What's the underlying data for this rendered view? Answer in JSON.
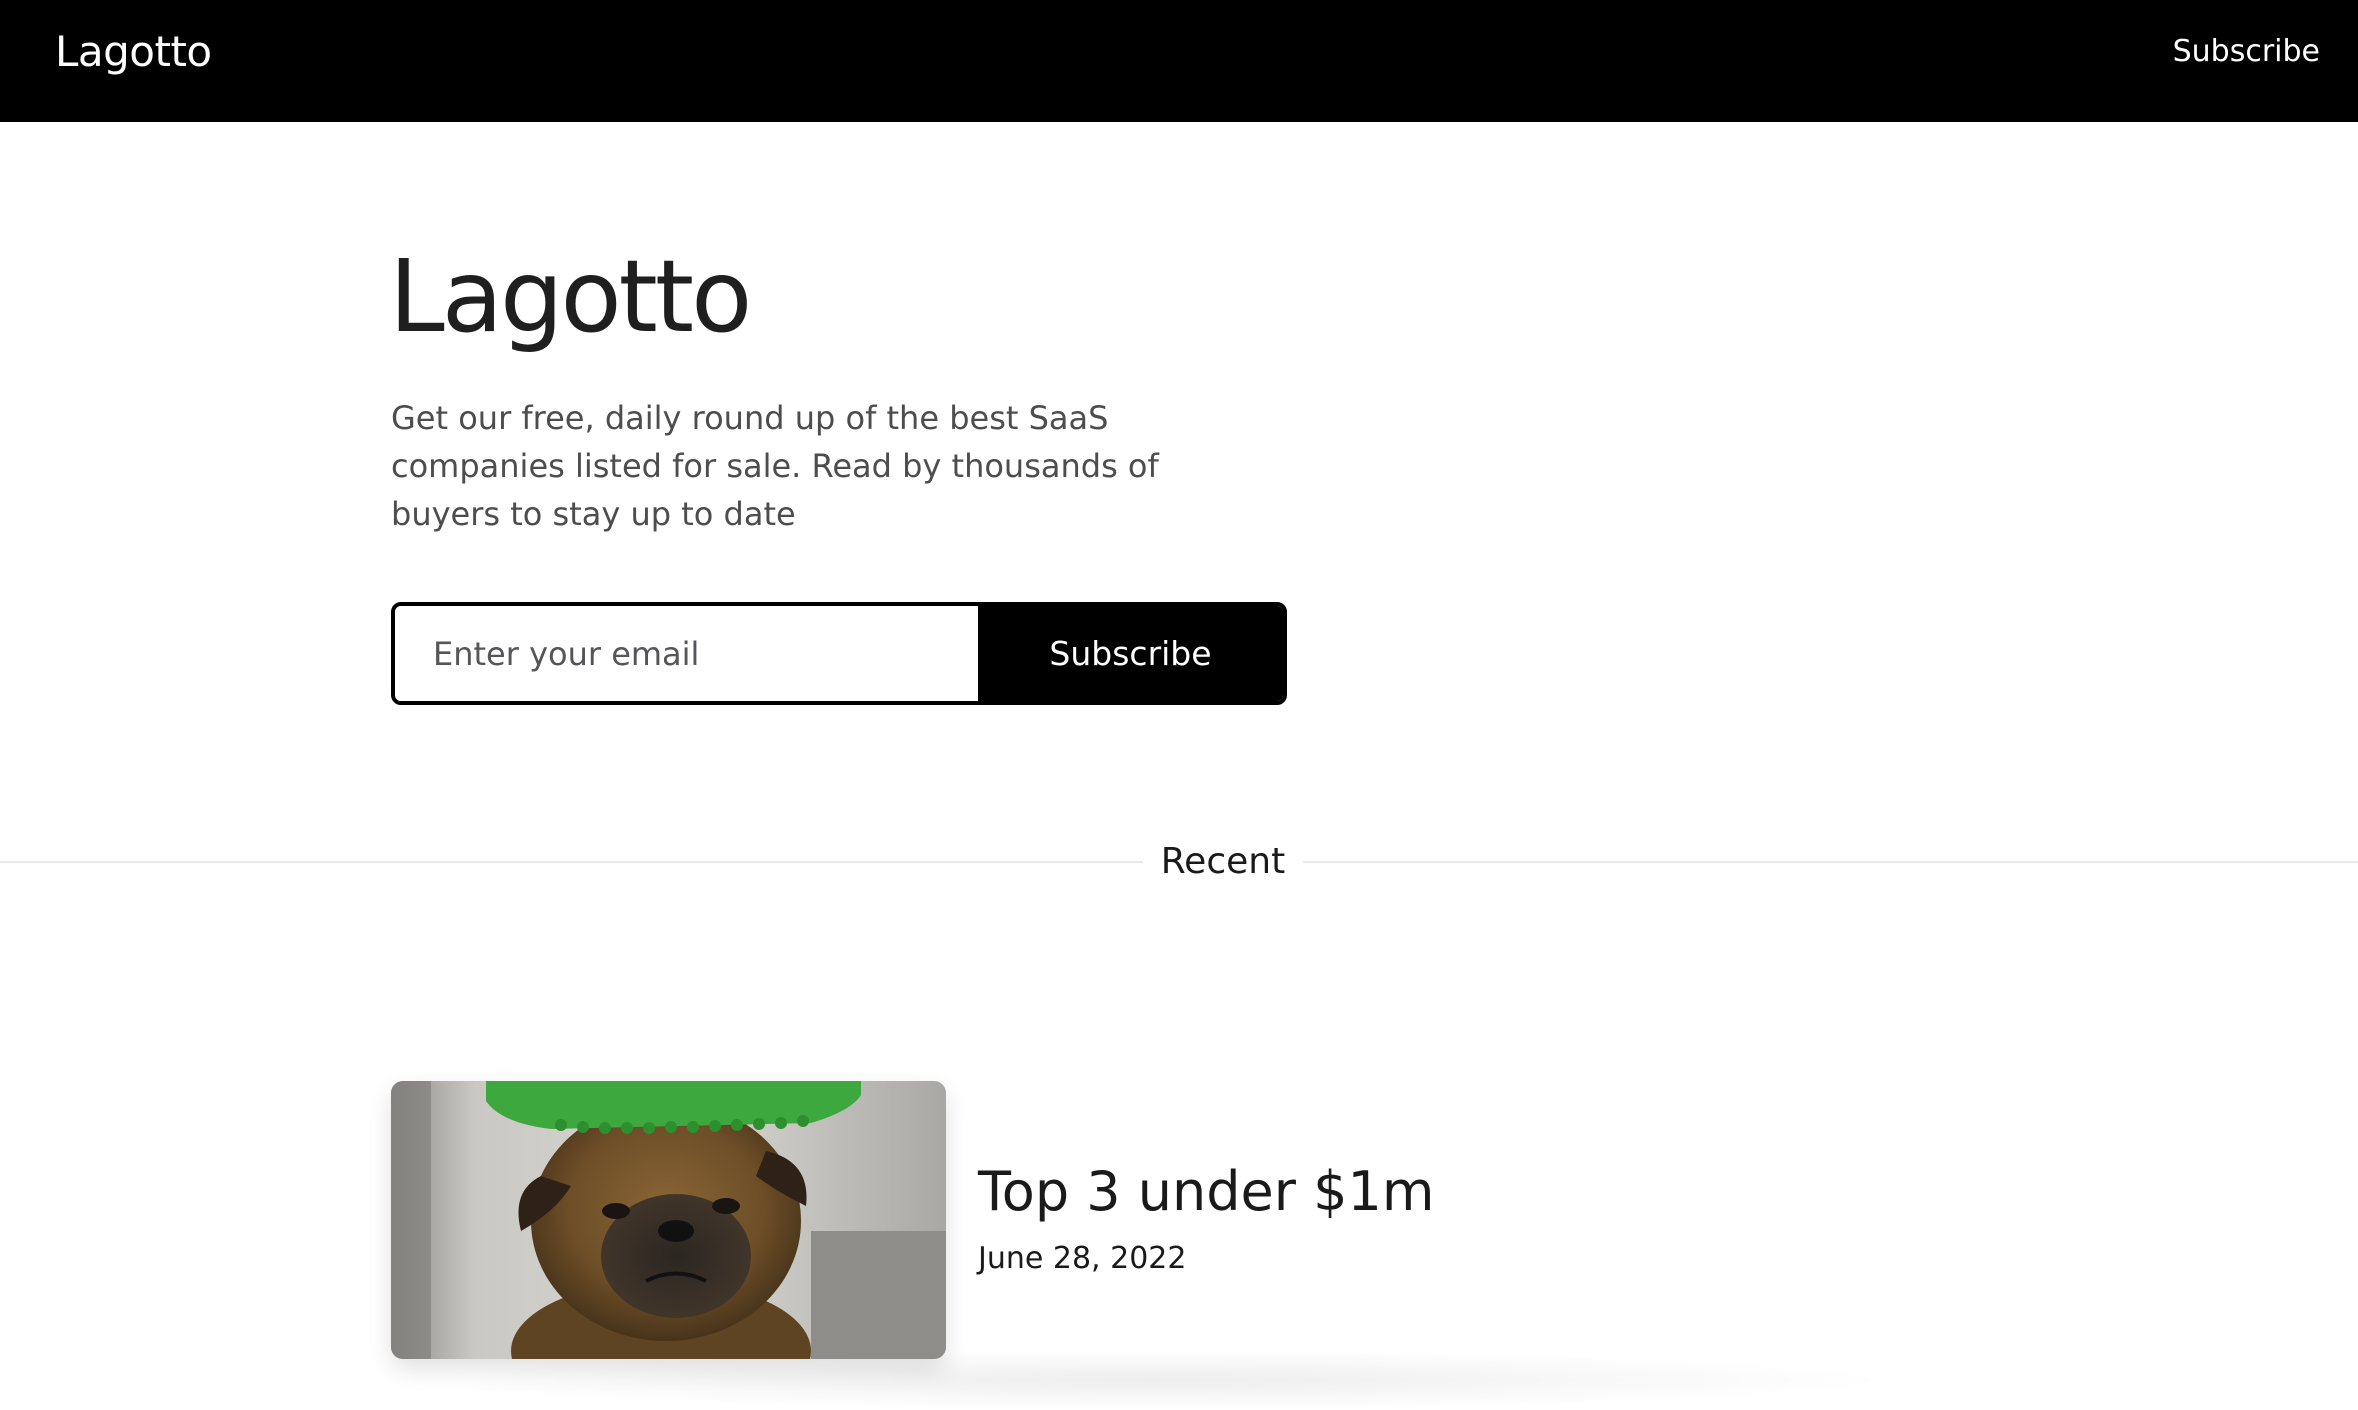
{
  "topbar": {
    "brand": "Lagotto",
    "subscribe_link": "Subscribe"
  },
  "hero": {
    "title": "Lagotto",
    "description": "Get our free, daily round up of the best SaaS companies listed for sale. Read by thousands of buyers to stay up to date"
  },
  "subscribe_form": {
    "email_placeholder": "Enter your email",
    "email_value": "",
    "button_label": "Subscribe"
  },
  "recent": {
    "label": "Recent"
  },
  "posts": [
    {
      "title": "Top 3 under $1m",
      "date": "June 28, 2022",
      "thumbnail": "dog-photo"
    }
  ],
  "colors": {
    "topbar_bg": "#000000",
    "button_bg": "#000000",
    "text": "#222222",
    "muted_text": "#4d4d4d",
    "divider": "#e9e9e9"
  }
}
